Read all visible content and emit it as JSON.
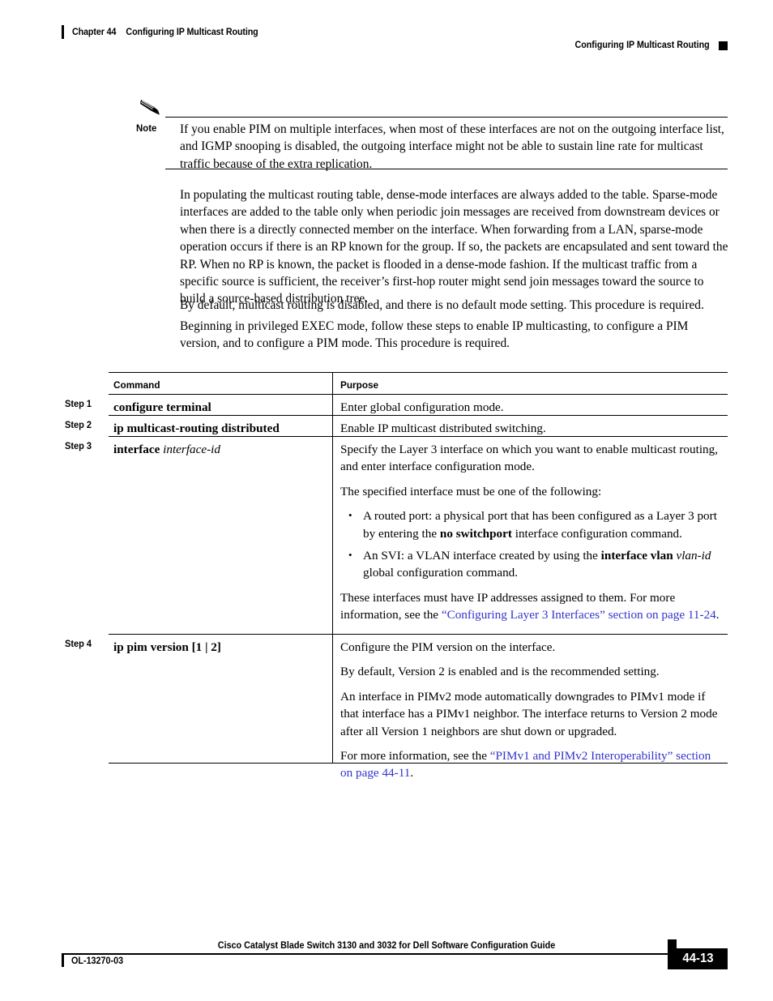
{
  "header": {
    "chapter_number": "Chapter 44",
    "chapter_title": "Configuring IP Multicast Routing",
    "running_head": "Configuring IP Multicast Routing"
  },
  "note": {
    "label": "Note",
    "icon": "pencil-icon",
    "text": "If you enable PIM on multiple interfaces, when most of these interfaces are not on the outgoing interface list, and IGMP snooping is disabled, the outgoing interface might not be able to sustain line rate for multicast traffic because of the extra replication."
  },
  "body": {
    "paragraph_1": "In populating the multicast routing table, dense-mode interfaces are always added to the table. Sparse-mode interfaces are added to the table only when periodic join messages are received from downstream devices or when there is a directly connected member on the interface. When forwarding from a LAN, sparse-mode operation occurs if there is an RP known for the group. If so, the packets are encapsulated and sent toward the RP. When no RP is known, the packet is flooded in a dense-mode fashion. If the multicast traffic from a specific source is sufficient, the receiver’s first-hop router might send join messages toward the source to build a source-based distribution tree.",
    "paragraph_2": "By default, multicast routing is disabled, and there is no default mode setting. This procedure is required.",
    "paragraph_3": "Beginning in privileged EXEC mode, follow these steps to enable IP multicasting, to configure a PIM version, and to configure a PIM mode. This procedure is required."
  },
  "table": {
    "headers": {
      "step": "",
      "command": "Command",
      "purpose": "Purpose"
    },
    "rows": [
      {
        "step": "Step 1",
        "command_bold": "configure terminal",
        "command_italic": "",
        "purpose_paragraphs": [
          "Enter global configuration mode."
        ]
      },
      {
        "step": "Step 2",
        "command_bold": "ip multicast-routing distributed",
        "command_italic": "",
        "purpose_paragraphs": [
          "Enable IP multicast distributed switching."
        ]
      },
      {
        "step": "Step 3",
        "command_bold": "interface",
        "command_italic": "interface-id",
        "purpose_paragraphs": [
          "Specify the Layer 3 interface on which you want to enable multicast routing, and enter interface configuration mode.",
          "The specified interface must be one of the following:"
        ],
        "bullets": [
          {
            "pre": "A routed port: a physical port that has been configured as a Layer 3 port by entering the ",
            "bold": "no switchport",
            "post": " interface configuration command."
          },
          {
            "pre": "An SVI: a VLAN interface created by using the ",
            "bold": "interface vlan",
            "italic": "vlan-id",
            "post": " global configuration command."
          }
        ],
        "closing": {
          "pre": "These interfaces must have IP addresses assigned to them. For more information, see the ",
          "link": "“Configuring Layer 3 Interfaces” section on page 11-24",
          "post": "."
        }
      },
      {
        "step": "Step 4",
        "command_bold": "ip pim version",
        "command_suffix": "[1 | 2]",
        "purpose_paragraphs": [
          "Configure the PIM version on the interface.",
          "By default, Version 2 is enabled and is the recommended setting.",
          "An interface in PIMv2 mode automatically downgrades to PIMv1 mode if that interface has a PIMv1 neighbor. The interface returns to Version 2 mode after all Version 1 neighbors are shut down or upgraded."
        ],
        "closing": {
          "pre": "For more information, see the ",
          "link": "“PIMv1 and PIMv2 Interoperability” section on page 44-11",
          "post": "."
        }
      }
    ]
  },
  "footer": {
    "guide_title": "Cisco Catalyst Blade Switch 3130 and 3032 for Dell Software Configuration Guide",
    "doc_id": "OL-13270-03",
    "page_number": "44-13"
  },
  "colors": {
    "link": "#3333cc",
    "text": "#000000",
    "rule": "#000000"
  }
}
